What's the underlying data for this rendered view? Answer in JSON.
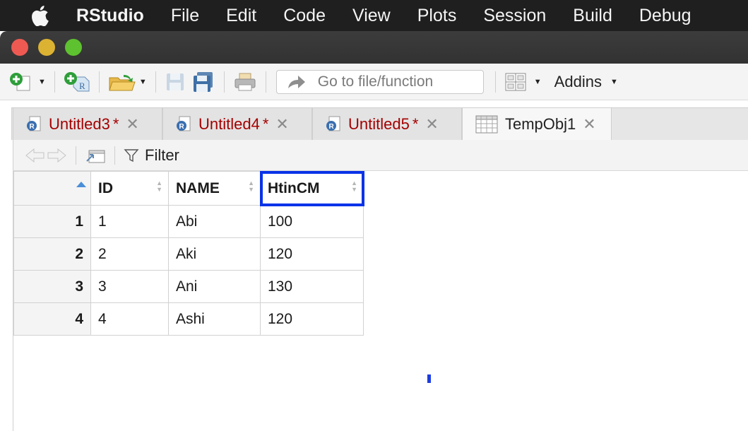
{
  "menubar": {
    "app": "RStudio",
    "items": [
      "File",
      "Edit",
      "Code",
      "View",
      "Plots",
      "Session",
      "Build",
      "Debug"
    ]
  },
  "toolbar": {
    "goto_placeholder": "Go to file/function",
    "addins_label": "Addins"
  },
  "tabs": [
    {
      "label": "Untitled3",
      "modified": "*",
      "type": "r-script"
    },
    {
      "label": "Untitled4",
      "modified": "*",
      "type": "r-script"
    },
    {
      "label": "Untitled5",
      "modified": "*",
      "type": "r-script"
    },
    {
      "label": "TempObj1",
      "modified": "",
      "type": "data-viewer",
      "active": true
    }
  ],
  "viewer": {
    "filter_label": "Filter"
  },
  "table": {
    "columns": [
      "ID",
      "NAME",
      "HtinCM"
    ],
    "rows": [
      {
        "index": "1",
        "cells": [
          "1",
          "Abi",
          "100"
        ]
      },
      {
        "index": "2",
        "cells": [
          "2",
          "Aki",
          "120"
        ]
      },
      {
        "index": "3",
        "cells": [
          "3",
          "Ani",
          "130"
        ]
      },
      {
        "index": "4",
        "cells": [
          "4",
          "Ashi",
          "120"
        ]
      }
    ]
  },
  "colors": {
    "menubar_bg": "#1f1f1f",
    "modified_tab_text": "#a40000",
    "highlight": "#0a33e8",
    "sort_active": "#4a8ed8"
  }
}
